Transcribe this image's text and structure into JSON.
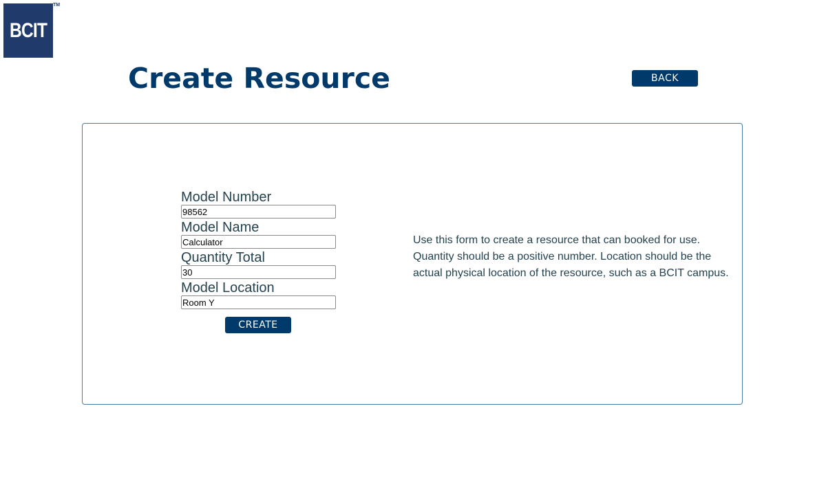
{
  "logo": {
    "text": "BCIT",
    "trademark": "TM"
  },
  "header": {
    "title": "Create Resource",
    "back_label": "BACK"
  },
  "form": {
    "fields": [
      {
        "label": "Model Number",
        "value": "98562"
      },
      {
        "label": "Model Name",
        "value": "Calculator"
      },
      {
        "label": "Quantity Total",
        "value": "30"
      },
      {
        "label": "Model Location",
        "value": "Room Y"
      }
    ],
    "submit_label": "CREATE"
  },
  "help": {
    "text": "Use this form to create a resource that can booked for use. Quantity should be a positive number. Location should be the actual physical location of the resource, such as a BCIT campus."
  },
  "colors": {
    "brand": "#003a6b",
    "logo_bg": "#1f3a6b",
    "card_border": "#4a7aa8",
    "text": "#24424f"
  }
}
